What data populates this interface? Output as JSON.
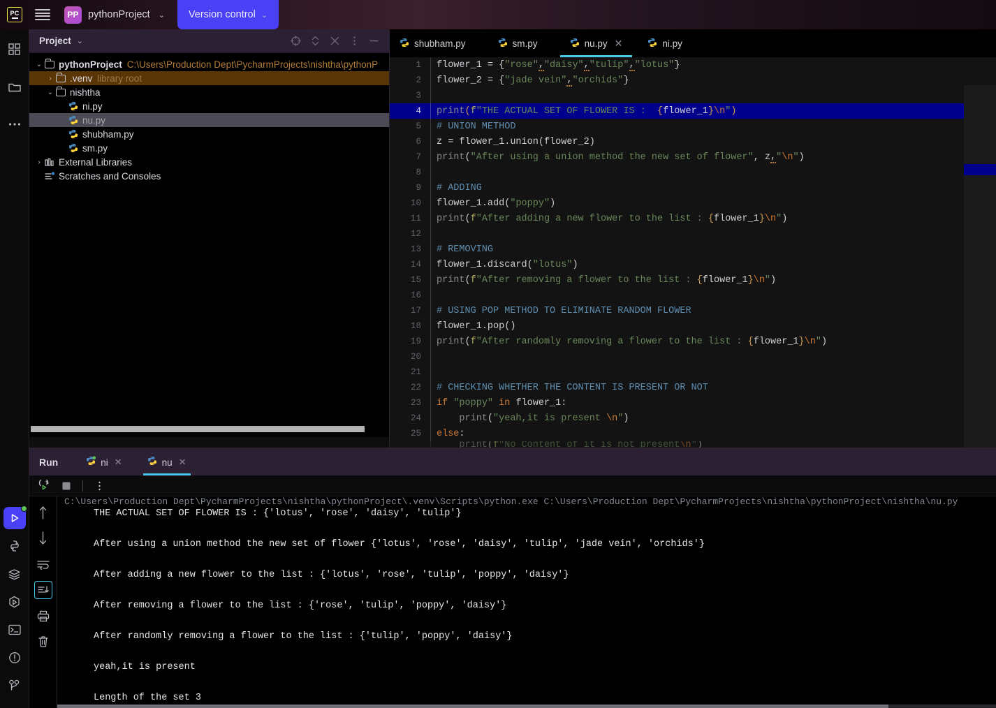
{
  "titlebar": {
    "logo_text": "PC",
    "logo_icon": "pycharm-logo-icon",
    "menu_icon": "hamburger-menu-icon",
    "project_badge": "PP",
    "project_name": "pythonProject",
    "project_chevron": "⌄",
    "vcs_label": "Version control",
    "vcs_chevron": "⌄"
  },
  "rail": {
    "top_items": [
      {
        "name": "project-structure-icon",
        "title": "Project"
      },
      {
        "name": "folder-icon",
        "title": "Files"
      },
      {
        "name": "more-options-icon",
        "title": "More tool windows"
      }
    ],
    "bottom_items": [
      {
        "name": "run-icon",
        "title": "Run"
      },
      {
        "name": "python-packages-icon",
        "title": "Python Packages"
      },
      {
        "name": "database-icon",
        "title": "Database"
      },
      {
        "name": "python-console-icon",
        "title": "Python Console"
      },
      {
        "name": "terminal-icon",
        "title": "Terminal"
      },
      {
        "name": "problems-icon",
        "title": "Problems"
      },
      {
        "name": "version-control-icon",
        "title": "Version Control"
      }
    ]
  },
  "project_panel": {
    "title": "Project",
    "title_chevron": "⌄",
    "header_icons": [
      {
        "name": "select-opened-file-icon"
      },
      {
        "name": "expand-collapse-icon"
      },
      {
        "name": "collapse-all-icon"
      },
      {
        "name": "options-menu-icon"
      },
      {
        "name": "hide-panel-icon"
      }
    ],
    "tree": [
      {
        "arrow": "⌄",
        "icon": "folder-icon",
        "label": "pythonProject",
        "bold": true,
        "path": "C:\\Users\\Production Dept\\PycharmProjects\\nishtha\\pythonP",
        "indent": 0,
        "state": "normal"
      },
      {
        "arrow": "›",
        "icon": "folder-icon",
        "label": ".venv",
        "suffix": "library root",
        "indent": 1,
        "state": "venv-highlight"
      },
      {
        "arrow": "⌄",
        "icon": "folder-icon",
        "label": "nishtha",
        "indent": 1,
        "state": "normal"
      },
      {
        "arrow": "",
        "icon": "python-file-icon",
        "label": "ni.py",
        "indent": 2,
        "state": "normal"
      },
      {
        "arrow": "",
        "icon": "python-file-icon",
        "label": "nu.py",
        "indent": 2,
        "state": "selected"
      },
      {
        "arrow": "",
        "icon": "python-file-icon",
        "label": "shubham.py",
        "indent": 2,
        "state": "normal"
      },
      {
        "arrow": "",
        "icon": "python-file-icon",
        "label": "sm.py",
        "indent": 2,
        "state": "normal"
      },
      {
        "arrow": "›",
        "icon": "external-libraries-icon",
        "label": "External Libraries",
        "indent": 0,
        "state": "normal"
      },
      {
        "arrow": "",
        "icon": "scratches-icon",
        "label": "Scratches and Consoles",
        "indent": 0,
        "state": "normal"
      }
    ]
  },
  "editor": {
    "tabs": [
      {
        "label": "shubham.py",
        "icon": "python-file-icon",
        "active": false,
        "closable": false
      },
      {
        "label": "sm.py",
        "icon": "python-file-icon",
        "active": false,
        "closable": false
      },
      {
        "label": "nu.py",
        "icon": "python-file-icon",
        "active": true,
        "closable": true,
        "close_glyph": "✕"
      },
      {
        "label": "ni.py",
        "icon": "python-file-icon",
        "active": false,
        "closable": false
      }
    ],
    "highlighted_line": 4,
    "lines": [
      {
        "n": "1",
        "text": "flower_1 = {\"rose\",\"daisy\",\"tulip\",\"lotus\"}"
      },
      {
        "n": "2",
        "text": "flower_2 = {\"jade vein\",\"orchids\"}"
      },
      {
        "n": "3",
        "text": ""
      },
      {
        "n": "4",
        "text": "print(f\"THE ACTUAL SET OF FLOWER IS :  {flower_1}\\n\")"
      },
      {
        "n": "5",
        "text": "# UNION METHOD"
      },
      {
        "n": "6",
        "text": "z = flower_1.union(flower_2)"
      },
      {
        "n": "7",
        "text": "print(\"After using a union method the new set of flower\", z,\"\\n\")"
      },
      {
        "n": "8",
        "text": ""
      },
      {
        "n": "9",
        "text": "# ADDING"
      },
      {
        "n": "10",
        "text": "flower_1.add(\"poppy\")"
      },
      {
        "n": "11",
        "text": "print(f\"After adding a new flower to the list : {flower_1}\\n\")"
      },
      {
        "n": "12",
        "text": ""
      },
      {
        "n": "13",
        "text": "# REMOVING"
      },
      {
        "n": "14",
        "text": "flower_1.discard(\"lotus\")"
      },
      {
        "n": "15",
        "text": "print(f\"After removing a flower to the list : {flower_1}\\n\")"
      },
      {
        "n": "16",
        "text": ""
      },
      {
        "n": "17",
        "text": "# USING POP METHOD TO ELIMINATE RANDOM FLOWER"
      },
      {
        "n": "18",
        "text": "flower_1.pop()"
      },
      {
        "n": "19",
        "text": "print(f\"After randomly removing a flower to the list : {flower_1}\\n\")"
      },
      {
        "n": "20",
        "text": ""
      },
      {
        "n": "21",
        "text": ""
      },
      {
        "n": "22",
        "text": "# CHECKING WHETHER THE CONTENT IS PRESENT OR NOT"
      },
      {
        "n": "23",
        "text": "if \"poppy\" in flower_1:"
      },
      {
        "n": "24",
        "text": "    print(\"yeah,it is present \\n\")"
      },
      {
        "n": "25",
        "text": "else:"
      }
    ]
  },
  "run_panel": {
    "title": "Run",
    "tabs": [
      {
        "label": "ni",
        "icon": "python-run-icon",
        "active": false,
        "close_glyph": "✕"
      },
      {
        "label": "nu",
        "icon": "python-run-icon",
        "active": true,
        "close_glyph": "✕"
      }
    ],
    "toolbar_icons": [
      {
        "name": "rerun-icon"
      },
      {
        "name": "stop-icon"
      },
      {
        "name": "more-options-icon"
      }
    ],
    "console_rail_icons": [
      {
        "name": "scroll-up-icon",
        "selected": false
      },
      {
        "name": "scroll-down-icon",
        "selected": false
      },
      {
        "name": "soft-wrap-icon",
        "selected": false
      },
      {
        "name": "scroll-to-end-icon",
        "selected": true
      },
      {
        "name": "print-icon",
        "selected": false
      },
      {
        "name": "clear-all-icon",
        "selected": false
      }
    ],
    "console_clipped_line": "C:\\Users\\Production Dept\\PycharmProjects\\nishtha\\pythonProject\\.venv\\Scripts\\python.exe   C:\\Users\\Production Dept\\PycharmProjects\\nishtha\\pythonProject\\nishtha\\nu.py",
    "console_lines": [
      "THE ACTUAL SET OF FLOWER IS :  {'lotus', 'rose', 'daisy', 'tulip'}",
      "",
      "After using a union method the new set of flower {'lotus', 'rose', 'daisy', 'tulip', 'jade vein', 'orchids'}",
      "",
      "After adding a new flower to the list : {'lotus', 'rose', 'tulip', 'poppy', 'daisy'}",
      "",
      "After removing a flower to the list : {'rose', 'tulip', 'poppy', 'daisy'}",
      "",
      "After randomly removing a flower to the list : {'tulip', 'poppy', 'daisy'}",
      "",
      "yeah,it is present",
      "",
      "Length of the set 3"
    ]
  },
  "colors": {
    "accent_blue": "#4a40f5",
    "tab_underline": "#49c7e8",
    "selection_blue": "#00008c",
    "venv_highlight": "#5a3505",
    "string_green": "#6a8759",
    "comment_blue": "#5e8dae",
    "keyword_orange": "#cc7832"
  }
}
